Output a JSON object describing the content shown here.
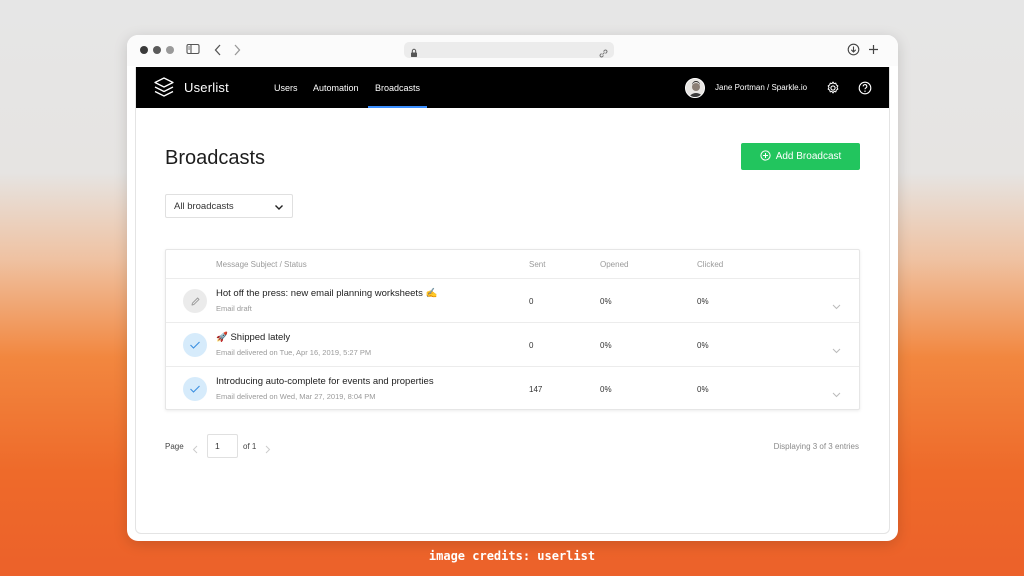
{
  "browser": {
    "url": ""
  },
  "nav": {
    "brand": "Userlist",
    "links": [
      {
        "label": "Users"
      },
      {
        "label": "Automation"
      },
      {
        "label": "Broadcasts",
        "active": true
      }
    ],
    "user": "Jane Portman / Sparkle.io",
    "icons": [
      "settings-icon",
      "help-icon"
    ]
  },
  "page": {
    "title": "Broadcasts",
    "add_button": "Add Broadcast",
    "filter": {
      "selected": "All broadcasts"
    }
  },
  "table": {
    "headers": {
      "subject": "Message Subject / Status",
      "sent": "Sent",
      "opened": "Opened",
      "clicked": "Clicked"
    },
    "rows": [
      {
        "subject": "Hot off the press: new email planning worksheets ✍️",
        "status": "Email draft",
        "sent": "0",
        "opened": "0%",
        "clicked": "0%",
        "state": "draft"
      },
      {
        "subject": "🚀 Shipped lately",
        "status": "Email delivered on Tue, Apr 16, 2019, 5:27 PM",
        "sent": "0",
        "opened": "0%",
        "clicked": "0%",
        "state": "sent"
      },
      {
        "subject": "Introducing auto-complete for events and properties",
        "status": "Email delivered on Wed, Mar 27, 2019, 8:04 PM",
        "sent": "147",
        "opened": "0%",
        "clicked": "0%",
        "state": "sent"
      }
    ]
  },
  "pagination": {
    "page_label": "Page",
    "current": "1",
    "of_label": "of 1",
    "entries": "Displaying 3 of 3 entries"
  },
  "credits": "image credits: userlist",
  "colors": {
    "accent_green": "#22c55e",
    "nav_bg": "#000000",
    "active_underline": "#3b8fff",
    "sent_icon_bg": "#d6ebfb"
  }
}
